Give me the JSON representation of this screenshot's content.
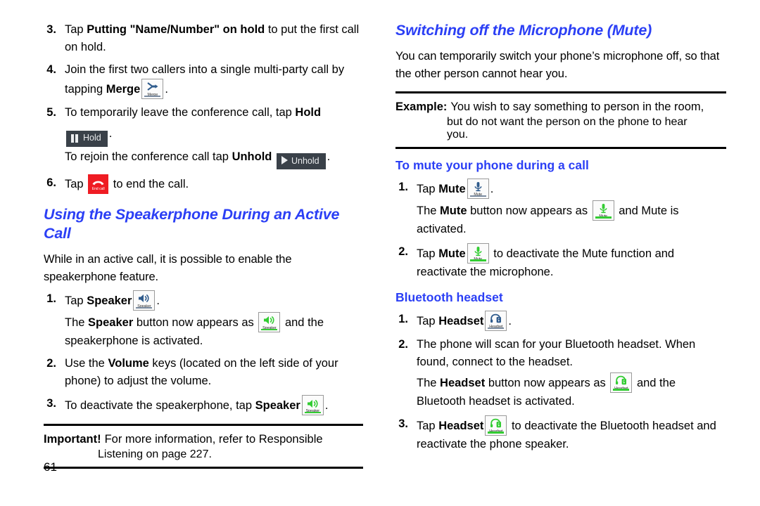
{
  "page": {
    "number": "61"
  },
  "left_column": {
    "steps": [
      {
        "num": "3.",
        "parts": [
          {
            "t": "Tap ",
            "b": false
          },
          {
            "t": "Putting \"Name/Number\" on hold",
            "b": true
          },
          {
            "t": " to put the first call on hold.",
            "b": false
          }
        ]
      },
      {
        "num": "4.",
        "parts": [
          {
            "t": "Join the first two callers into a single multi-party call by tapping ",
            "b": false
          },
          {
            "t": "Merge",
            "b": true
          }
        ],
        "icon": "merge-icon",
        "trail": "."
      },
      {
        "num": "5.",
        "parts": [
          {
            "t": "To temporarily leave the conference call, tap ",
            "b": false
          },
          {
            "t": "Hold",
            "b": true
          }
        ]
      },
      {
        "num": "6.",
        "parts": [
          {
            "t": "Tap ",
            "b": false
          }
        ],
        "trail": " to end the call."
      }
    ],
    "step5_line2_pre": "To rejoin the conference call tap ",
    "step5_line2_bold": "Unhold",
    "step5_line2_post": ".",
    "heading_speakerphone": "Using the Speakerphone During an Active Call",
    "speaker_intro": "While in an active call, it is possible to enable the speakerphone feature.",
    "speaker_steps": [
      {
        "num": "1.",
        "pre": "Tap ",
        "bold": "Speaker",
        "post": ".",
        "sub_pre": "The ",
        "sub_bold": "Speaker",
        "sub_mid": " button now appears as ",
        "sub_post": " and the speakerphone is activated."
      },
      {
        "num": "2.",
        "pre": "Use the ",
        "bold": "Volume",
        "post": " keys (located on the left side of your phone) to adjust the volume."
      },
      {
        "num": "3.",
        "pre": "To deactivate the speakerphone, tap ",
        "bold": "Speaker",
        "post": "."
      }
    ],
    "important_note": {
      "label": "Important!",
      "text": "For more information, refer to  Responsible",
      "line2": "Listening on page 227."
    }
  },
  "right_column": {
    "heading_mute": "Switching off the Microphone (Mute)",
    "mute_intro": "You can temporarily switch your phone’s microphone off, so that the other person cannot hear you.",
    "example_note": {
      "label": "Example:",
      "text": "You wish to say something to person in the room,",
      "line2": "but do not want the person on the phone to hear",
      "line3": "you."
    },
    "heading_to_mute": "To mute your phone during a call",
    "mute_steps": [
      {
        "num": "1.",
        "pre": "Tap ",
        "bold": "Mute",
        "post": ".",
        "sub_pre": "The ",
        "sub_bold": "Mute",
        "sub_mid": " button now appears as ",
        "sub_post": " and Mute is activated."
      },
      {
        "num": "2.",
        "pre": "Tap ",
        "bold": "Mute",
        "post": " to deactivate the Mute function and reactivate the microphone."
      }
    ],
    "heading_bluetooth": "Bluetooth headset",
    "bt_steps": [
      {
        "num": "1.",
        "pre": "Tap ",
        "bold": "Headset",
        "post": "."
      },
      {
        "num": "2.",
        "pre": "The phone will scan for your Bluetooth headset. When found, connect to the headset.",
        "sub_pre": "The ",
        "sub_bold": "Headset",
        "sub_mid": " button now appears as ",
        "sub_post": " and the Bluetooth headset is activated."
      },
      {
        "num": "3.",
        "pre": "Tap ",
        "bold": "Headset",
        "post": " to deactivate the Bluetooth headset and reactivate the phone speaker."
      }
    ]
  },
  "icons": {
    "merge_label": "Merge",
    "hold_label": "Hold",
    "unhold_label": "Unhold",
    "endcall_label": "End call",
    "speaker_label": "Speaker",
    "mute_label": "Mute",
    "headset_label": "Headset"
  },
  "colors": {
    "heading_blue": "#2b3ff5",
    "active_green": "#32cc32",
    "icon_blue": "#2f5b8c",
    "endcall_red": "#ef1c23",
    "pill_dark": "#3a4149"
  }
}
